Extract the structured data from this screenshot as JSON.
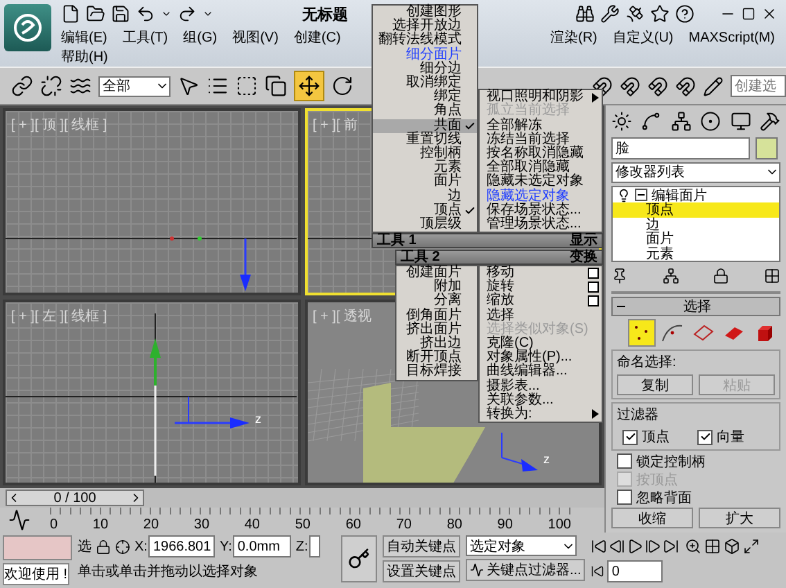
{
  "title": "无标题",
  "menu": {
    "left": [
      "编辑(E)",
      "工具(T)",
      "组(G)",
      "视图(V)",
      "创建(C)"
    ],
    "right": [
      "渲染(R)",
      "自定义(U)",
      "MAXScript(M)"
    ],
    "second_row": [
      "帮助(H)"
    ]
  },
  "toolbar": {
    "selection_filter": "全部",
    "move_selected": true,
    "named_selection": {
      "placeholder": "创建选"
    }
  },
  "viewports": [
    {
      "label": "[ + ][ 顶 ][ 线框 ]",
      "kind": "ortho",
      "active": false
    },
    {
      "label": "[ + ][ 前",
      "kind": "ortho",
      "active": true
    },
    {
      "label": "[ + ][ 左 ][ 线框 ]",
      "kind": "ortho",
      "active": false,
      "axis_label": "z"
    },
    {
      "label": "[ + ][ 透视",
      "kind": "perspective",
      "active": false,
      "axis_label": "z"
    }
  ],
  "quad_menu": {
    "tools1": {
      "title": "工具 1",
      "items": [
        {
          "label": "创建图形",
          "checked": false,
          "selected": false,
          "recent": false
        },
        {
          "label": "选择开放边",
          "checked": false,
          "selected": false,
          "recent": false
        },
        {
          "label": "翻转法线模式",
          "checked": false,
          "selected": false,
          "recent": false
        },
        {
          "label": "细分面片",
          "checked": false,
          "selected": false,
          "recent": true
        },
        {
          "label": "细分边",
          "checked": false,
          "selected": false,
          "recent": false
        },
        {
          "label": "取消绑定",
          "checked": false,
          "selected": false,
          "recent": false
        },
        {
          "label": "绑定",
          "checked": false,
          "selected": false,
          "recent": false
        },
        {
          "label": "角点",
          "checked": false,
          "selected": false,
          "recent": false
        },
        {
          "label": "共面",
          "checked": true,
          "selected": true,
          "recent": false
        },
        {
          "label": "重置切线",
          "checked": false,
          "selected": false,
          "recent": false
        },
        {
          "label": "控制柄",
          "checked": false,
          "selected": false,
          "recent": false
        },
        {
          "label": "元素",
          "checked": false,
          "selected": false,
          "recent": false
        },
        {
          "label": "面片",
          "checked": false,
          "selected": false,
          "recent": false
        },
        {
          "label": "边",
          "checked": false,
          "selected": false,
          "recent": false
        },
        {
          "label": "顶点",
          "checked": true,
          "selected": false,
          "recent": false
        },
        {
          "label": "顶层级",
          "checked": false,
          "selected": false,
          "recent": false
        }
      ]
    },
    "display": {
      "title": "显示",
      "items": [
        {
          "label": "视口照明和阴影",
          "disabled": false,
          "recent": false,
          "submenu": true
        },
        {
          "label": "孤立当前选择",
          "disabled": true,
          "recent": false,
          "submenu": false
        },
        {
          "label": "全部解冻",
          "disabled": false,
          "recent": false,
          "submenu": false
        },
        {
          "label": "冻结当前选择",
          "disabled": false,
          "recent": false,
          "submenu": false
        },
        {
          "label": "按名称取消隐藏",
          "disabled": false,
          "recent": false,
          "submenu": false
        },
        {
          "label": "全部取消隐藏",
          "disabled": false,
          "recent": false,
          "submenu": false
        },
        {
          "label": "隐藏未选定对象",
          "disabled": false,
          "recent": false,
          "submenu": false
        },
        {
          "label": "隐藏选定对象",
          "disabled": false,
          "recent": true,
          "submenu": false
        },
        {
          "label": "保存场景状态...",
          "disabled": false,
          "recent": false,
          "submenu": false
        },
        {
          "label": "管理场景状态...",
          "disabled": false,
          "recent": false,
          "submenu": false
        }
      ]
    },
    "tools2": {
      "title": "工具 2",
      "items": [
        "创建面片",
        "附加",
        "分离",
        "倒角面片",
        "挤出面片",
        "挤出边",
        "断开顶点",
        "目标焊接"
      ]
    },
    "transform": {
      "title": "变换",
      "items": [
        {
          "label": "移动",
          "disabled": false,
          "options": true,
          "submenu": false
        },
        {
          "label": "旋转",
          "disabled": false,
          "options": true,
          "submenu": false
        },
        {
          "label": "缩放",
          "disabled": false,
          "options": true,
          "submenu": false
        },
        {
          "label": "选择",
          "disabled": false,
          "options": false,
          "submenu": false
        },
        {
          "label": "选择类似对象(S)",
          "disabled": true,
          "options": false,
          "submenu": false
        },
        {
          "label": "克隆(C)",
          "disabled": false,
          "options": false,
          "submenu": false
        },
        {
          "label": "对象属性(P)...",
          "disabled": false,
          "options": false,
          "submenu": false
        },
        {
          "label": "曲线编辑器...",
          "disabled": false,
          "options": false,
          "submenu": false
        },
        {
          "label": "摄影表...",
          "disabled": false,
          "options": false,
          "submenu": false
        },
        {
          "label": "关联参数...",
          "disabled": false,
          "options": false,
          "submenu": false
        },
        {
          "label": "转换为:",
          "disabled": false,
          "options": false,
          "submenu": true
        }
      ]
    }
  },
  "command_panel": {
    "object_name": "脸",
    "modifier_list": "修改器列表",
    "stack": {
      "modifier": "编辑面片",
      "expanded": true,
      "children": [
        {
          "label": "顶点",
          "selected": true
        },
        {
          "label": "边",
          "selected": false
        },
        {
          "label": "面片",
          "selected": false
        },
        {
          "label": "元素",
          "selected": false
        }
      ]
    },
    "rollout": {
      "title": "选择",
      "expanded": true,
      "levels": [
        {
          "kind": "vertex",
          "selected": true
        },
        {
          "kind": "handle",
          "selected": false
        },
        {
          "kind": "edge",
          "selected": false
        },
        {
          "kind": "patch",
          "selected": false
        },
        {
          "kind": "element",
          "selected": false
        }
      ],
      "named_selection": {
        "title": "命名选择:",
        "buttons": [
          {
            "label": "复制",
            "disabled": false
          },
          {
            "label": "粘贴",
            "disabled": true
          }
        ]
      },
      "filter": {
        "title": "过滤器",
        "options": [
          {
            "label": "顶点",
            "checked": true
          },
          {
            "label": "向量",
            "checked": true
          }
        ]
      },
      "options": [
        {
          "label": "锁定控制柄",
          "checked": false,
          "disabled": false
        },
        {
          "label": "按顶点",
          "checked": false,
          "disabled": true
        },
        {
          "label": "忽略背面",
          "checked": false,
          "disabled": false
        }
      ],
      "buttons": [
        "收缩",
        "扩大"
      ]
    }
  },
  "time_slider": {
    "position": "0 / 100",
    "ticks": [
      "0",
      "10",
      "20",
      "30",
      "40",
      "50",
      "60",
      "70",
      "80",
      "90",
      "100"
    ]
  },
  "status": {
    "welcome": "欢迎使用 !",
    "selection_toggle": "选",
    "coordinates": [
      {
        "axis": "X:",
        "value": "1966.801"
      },
      {
        "axis": "Y:",
        "value": "0.0mm"
      },
      {
        "axis": "Z:"
      }
    ],
    "prompt": "单击或单击并拖动以选择对象"
  },
  "animation": {
    "auto_key": "自动关键点",
    "set_key": "设置关键点",
    "key_mode": "选定对象",
    "key_filters": "关键点过滤器...",
    "frame": "0"
  }
}
